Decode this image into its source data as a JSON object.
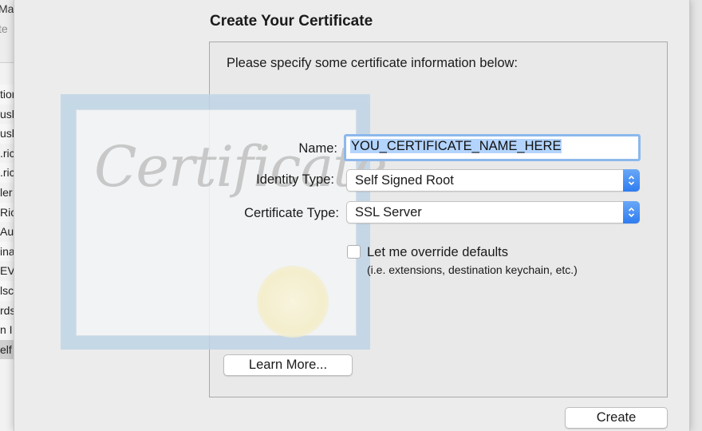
{
  "background_window": {
    "top_lines": [
      "Ma",
      "te"
    ],
    "list_rows": [
      "tion",
      "ush",
      "ush",
      ".ric",
      ".ric",
      "ler",
      "Ric",
      "Au",
      "ina",
      "EV",
      "lsc",
      "rds",
      "n I",
      "elf"
    ]
  },
  "dialog": {
    "title": "Create Your Certificate",
    "intro": "Please specify some certificate information below:",
    "artwork_text": "Certificate",
    "name_label": "Name:",
    "name_value": "YOU_CERTIFICATE_NAME_HERE",
    "identity_type_label": "Identity Type:",
    "identity_type_value": "Self Signed Root",
    "certificate_type_label": "Certificate Type:",
    "certificate_type_value": "SSL Server",
    "override_label": "Let me override defaults",
    "override_hint": "(i.e. extensions, destination keychain, etc.)",
    "override_checked": false,
    "learn_more_label": "Learn More...",
    "create_label": "Create"
  },
  "colors": {
    "accent": "#2f7cf0",
    "focus_ring": "#8cb8ec",
    "selection": "#b3d4fd"
  }
}
